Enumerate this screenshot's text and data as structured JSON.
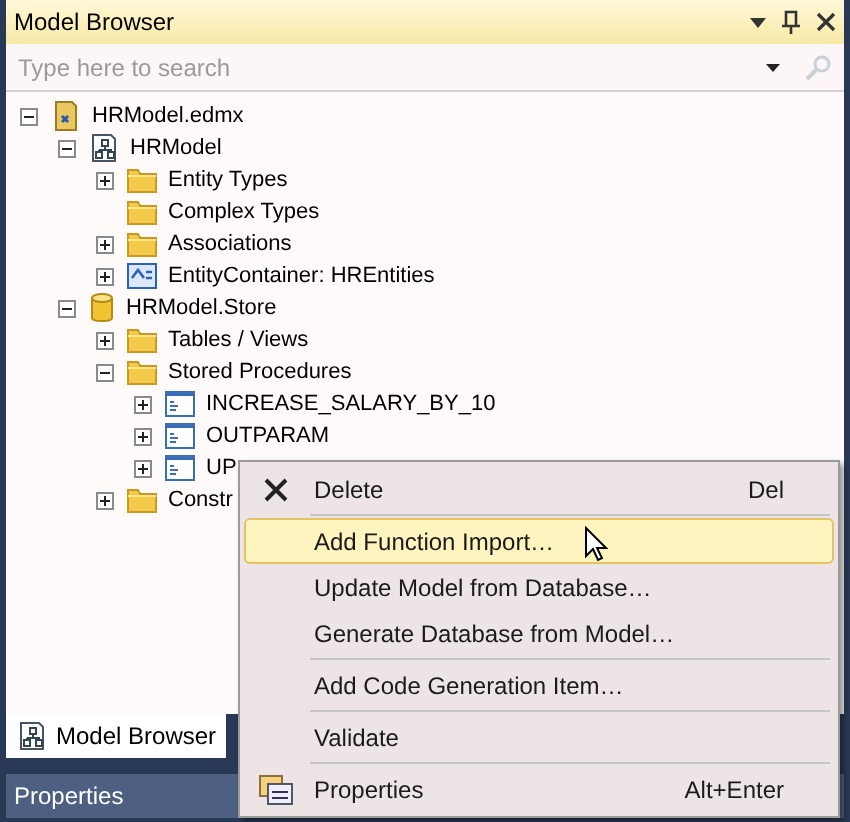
{
  "panel": {
    "title": "Model Browser"
  },
  "search": {
    "placeholder": "Type here to search"
  },
  "tree": [
    {
      "label": "HRModel.edmx",
      "kind": "file",
      "expanded": true,
      "children": [
        {
          "label": "HRModel",
          "kind": "model",
          "expanded": true,
          "children": [
            {
              "label": "Entity Types",
              "kind": "folder",
              "expanded": false
            },
            {
              "label": "Complex Types",
              "kind": "folder"
            },
            {
              "label": "Associations",
              "kind": "folder",
              "expanded": false
            },
            {
              "label": "EntityContainer: HREntities",
              "kind": "container",
              "expanded": false
            }
          ]
        },
        {
          "label": "HRModel.Store",
          "kind": "database",
          "expanded": true,
          "children": [
            {
              "label": "Tables / Views",
              "kind": "folder",
              "expanded": false
            },
            {
              "label": "Stored Procedures",
              "kind": "folder",
              "expanded": true,
              "children": [
                {
                  "label": "INCREASE_SALARY_BY_10",
                  "kind": "procedure",
                  "expanded": false
                },
                {
                  "label": "OUTPARAM",
                  "kind": "procedure",
                  "expanded": false
                },
                {
                  "label": "UP",
                  "kind": "procedure",
                  "expanded": false
                }
              ]
            },
            {
              "label": "Constr",
              "kind": "folder",
              "expanded": false
            }
          ]
        }
      ]
    }
  ],
  "tabs": [
    {
      "label": "Model Browser",
      "selected": true
    }
  ],
  "properties_panel": {
    "title": "Properties"
  },
  "context_menu": [
    {
      "label": "Delete",
      "kind": "delete",
      "shortcut": "Del",
      "selected": false
    },
    {
      "label": "Add Function Import…",
      "kind": "plain",
      "separator_before": true,
      "selected": true
    },
    {
      "label": "Update Model from Database…",
      "kind": "plain",
      "selected": false
    },
    {
      "label": "Generate Database from Model…",
      "kind": "plain",
      "selected": false
    },
    {
      "label": "Add Code Generation Item…",
      "kind": "plain",
      "separator_before": true,
      "selected": false
    },
    {
      "label": "Validate",
      "kind": "plain",
      "separator_before": true,
      "selected": false
    },
    {
      "label": "Properties",
      "kind": "properties",
      "shortcut": "Alt+Enter",
      "separator_before": true,
      "selected": false
    }
  ]
}
